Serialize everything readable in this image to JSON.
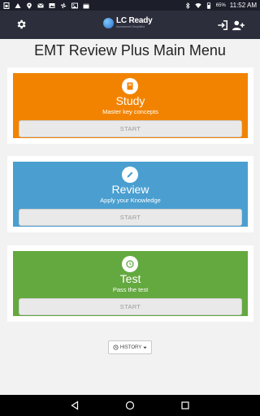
{
  "status_bar": {
    "time": "11:52 AM",
    "battery": "65%",
    "icons": [
      "sim-icon",
      "triangle-icon",
      "location-icon",
      "mail-icon",
      "photo-icon",
      "pinwheel-icon",
      "image-icon",
      "calendar-icon"
    ]
  },
  "app_bar": {
    "logo_text": "LC Ready",
    "logo_tagline": "Assessment Simplified",
    "settings_icon": "gear-icon",
    "login_icon": "sign-in-icon",
    "add_user_icon": "user-plus-icon"
  },
  "page_title": "EMT Review Plus Main Menu",
  "cards": [
    {
      "title": "Study",
      "subtitle": "Master key concepts",
      "button": "START",
      "color": "#f28300",
      "icon": "book-icon"
    },
    {
      "title": "Review",
      "subtitle": "Apply your Knowledge",
      "button": "START",
      "color": "#4a9fd0",
      "icon": "pencil-icon"
    },
    {
      "title": "Test",
      "subtitle": "Pass the test",
      "button": "START",
      "color": "#64a93f",
      "icon": "clock-icon"
    }
  ],
  "history": {
    "label": "HISTORY",
    "icon": "clock-icon"
  },
  "nav_bar": {
    "icons": [
      "back-icon",
      "home-icon",
      "recents-icon"
    ]
  }
}
